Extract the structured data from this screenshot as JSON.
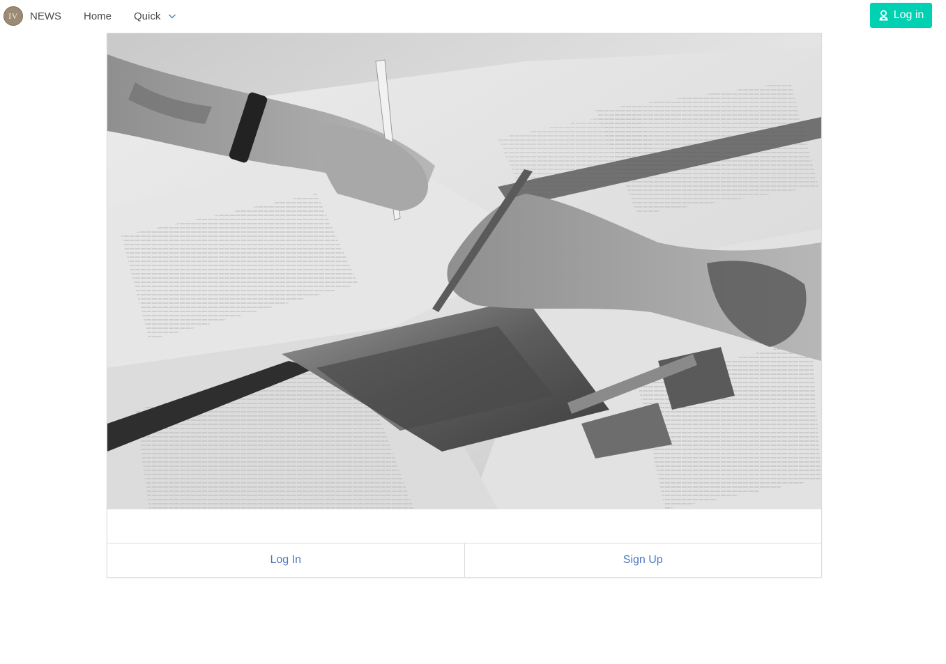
{
  "navbar": {
    "logo_text": "IV",
    "brand": "NEWS",
    "home": "Home",
    "quick": "Quick",
    "login": "Log in"
  },
  "card": {
    "footer": {
      "login": "Log In",
      "signup": "Sign Up"
    }
  },
  "colors": {
    "primary": "#00d1b2",
    "link": "#4a78c0",
    "logo": "#9b8a74"
  },
  "icons": {
    "quick_dropdown": "chevron-down-icon",
    "login": "user-icon"
  }
}
